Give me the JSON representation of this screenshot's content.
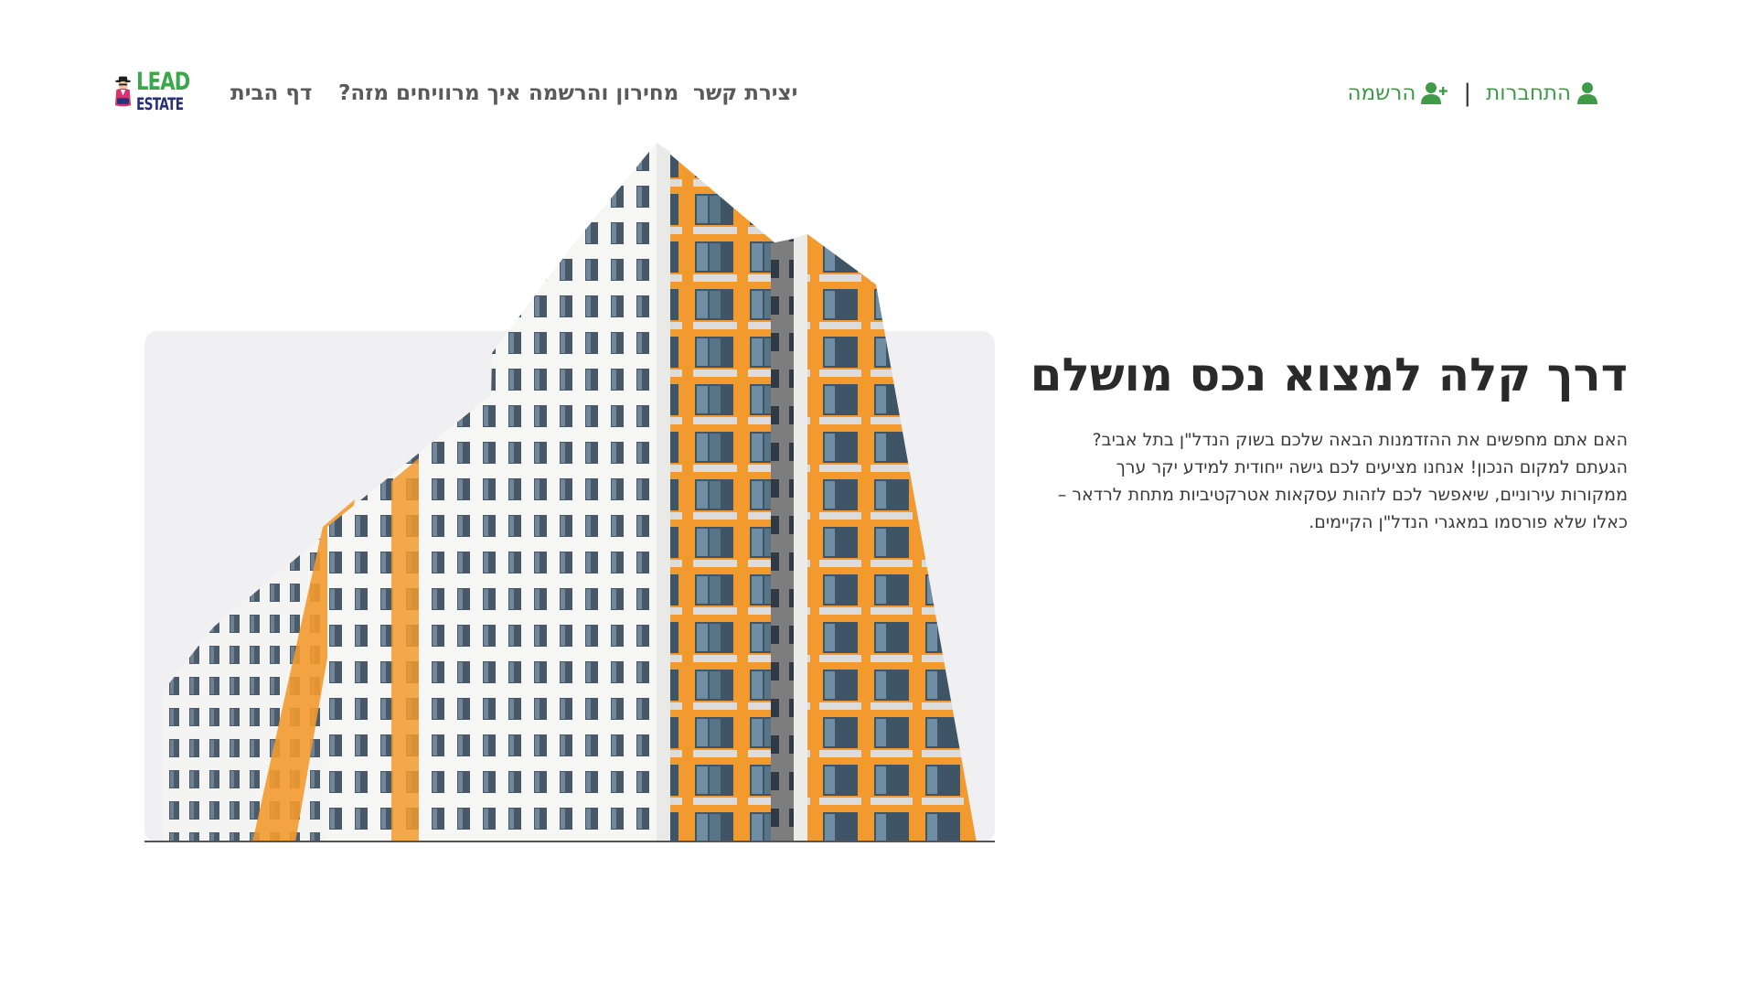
{
  "header": {
    "logo": {
      "line1": "LEAD",
      "line2": "ESTATE"
    },
    "nav": [
      {
        "label": "דף הבית"
      },
      {
        "label": "איך מרוויחים מזה?"
      },
      {
        "label": "מחירון והרשמה"
      },
      {
        "label": "יצירת קשר"
      }
    ],
    "auth": {
      "login_label": "התחברות",
      "register_label": "הרשמה",
      "separator": "|"
    }
  },
  "hero": {
    "title": "דרך קלה למצוא נכס מושלם",
    "body_lines": [
      "האם אתם מחפשים את ההזדמנות הבאה שלכם בשוק הנדל\"ן בתל אביב?",
      "הגעתם למקום הנכון! אנחנו מציעים לכם גישה ייחודית למידע יקר ערך",
      "ממקורות עירוניים, שיאפשר לכם לזהות עסקאות אטרקטיביות מתחת לרדאר –",
      "כאלו שלא פורסמו במאגרי הנדל\"ן הקיימים."
    ]
  },
  "colors": {
    "brand_green": "#3aa84a",
    "brand_navy": "#2a2f7a",
    "facade_orange": "#f39a2e",
    "nav_text": "#5a5a5a"
  }
}
